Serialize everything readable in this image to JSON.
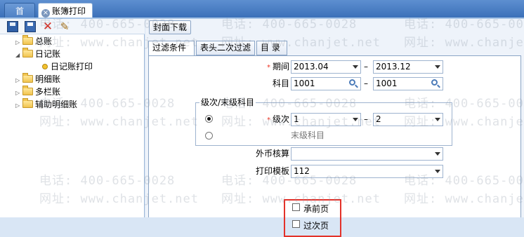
{
  "tabs": {
    "home": "首页",
    "active": "账簿打印"
  },
  "tree": {
    "nodes": [
      {
        "label": "总账"
      },
      {
        "label": "日记账"
      },
      {
        "label": "日记账打印"
      },
      {
        "label": "明细账"
      },
      {
        "label": "多栏账"
      },
      {
        "label": "辅助明细账"
      }
    ]
  },
  "toolbar": {
    "cover_download": "封面下载"
  },
  "subtabs": [
    "过滤条件",
    "表头二次过滤",
    "目 录"
  ],
  "form": {
    "period_label": "期间",
    "period_from": "2013.04",
    "period_to": "2013.12",
    "subject_label": "科目",
    "subject_from": "1001",
    "subject_to": "1001",
    "dash": "–",
    "group_title": "级次/末级科目",
    "level_label": "级次",
    "level_from": "1",
    "level_to": "2",
    "last_level_label": "末级科目",
    "currency_label": "外币核算",
    "currency_value": "",
    "template_label": "打印模板",
    "template_value": "112",
    "carry_forward_label": "承前页",
    "carry_over_label": "过次页"
  },
  "watermark": {
    "phone": "电话: 400-665-0028",
    "site": "网址: www.chanjet.net"
  },
  "colors": {
    "tab_bar": "#3a6fb8",
    "required": "#e32222",
    "highlight_box": "#e3322a"
  }
}
